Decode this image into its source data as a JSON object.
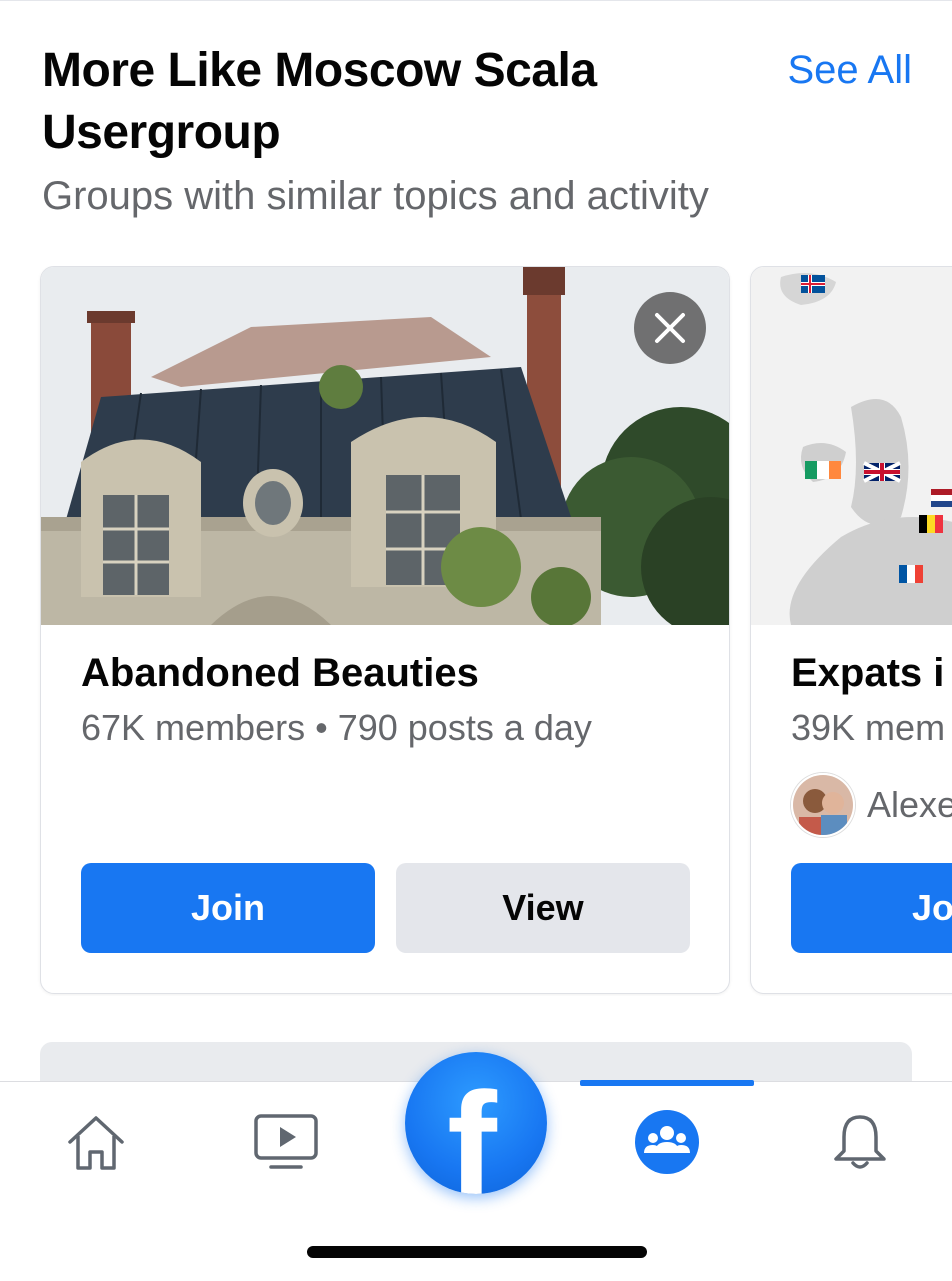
{
  "section": {
    "title": "More Like Moscow Scala Usergroup",
    "see_all": "See All",
    "subtitle": "Groups with similar topics and activity"
  },
  "cards": [
    {
      "name": "Abandoned Beauties",
      "members": "67K members",
      "separator": "•",
      "posts": "790 posts a day",
      "join_label": "Join",
      "view_label": "View",
      "image": "abandoned-chateau-photo"
    },
    {
      "name": "Expats i",
      "members": "39K mem",
      "friend": "Alexe",
      "join_label": "Joi",
      "image": "europe-map-with-flags"
    }
  ],
  "tab_bar": {
    "tabs": [
      "home-icon",
      "watch-icon",
      "facebook-logo",
      "groups-icon",
      "bell-icon"
    ],
    "active": "groups",
    "logo_letter": "f"
  },
  "colors": {
    "accent": "#1877f2",
    "secondary_button": "#e4e6eb",
    "secondary_text": "#65676b",
    "primary_text": "#050505"
  }
}
